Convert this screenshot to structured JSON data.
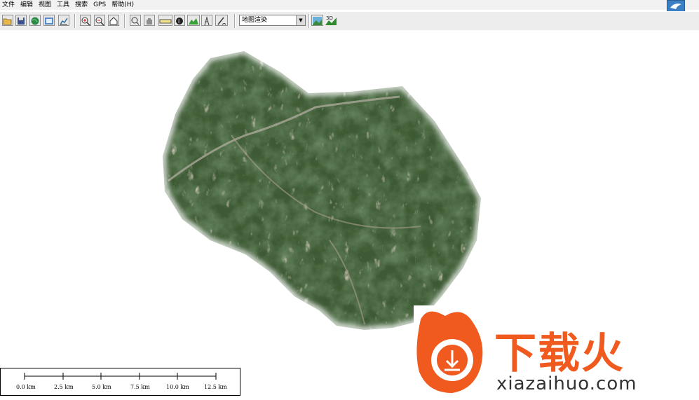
{
  "menubar": {
    "items": [
      {
        "label": "文件"
      },
      {
        "label": "编辑"
      },
      {
        "label": "视图"
      },
      {
        "label": "工具"
      },
      {
        "label": "搜索"
      },
      {
        "label": "GPS"
      },
      {
        "label": "帮助(H)"
      }
    ]
  },
  "toolbar": {
    "buttons": [
      {
        "icon": "open-folder-icon"
      },
      {
        "icon": "save-icon"
      },
      {
        "icon": "globe-icon"
      },
      {
        "icon": "export-map-icon"
      },
      {
        "icon": "chart-icon"
      },
      {
        "icon": "zoom-in-icon"
      },
      {
        "icon": "zoom-out-icon"
      },
      {
        "icon": "home-icon"
      },
      {
        "icon": "select-tool-icon"
      },
      {
        "icon": "pan-hand-icon"
      },
      {
        "icon": "measure-ruler-icon"
      },
      {
        "icon": "info-icon"
      },
      {
        "icon": "terrain-profile-icon"
      },
      {
        "icon": "gps-tower-icon"
      },
      {
        "icon": "draw-pen-icon"
      },
      {
        "icon": "map-view-icon"
      },
      {
        "icon": "3d-view-icon"
      }
    ],
    "layer_select_value": "地图渲染",
    "view_3d_label": "3D"
  },
  "scalebar": {
    "labels": [
      "0.0 km",
      "2.5 km",
      "5.0 km",
      "7.5 km",
      "10.0 km",
      "12.5 km"
    ]
  },
  "watermark": {
    "brand": "下载火",
    "url": "xiazaihuo.com"
  },
  "colors": {
    "map_dark_green": "#2f4a2a",
    "map_mid_green": "#4a6a3a",
    "map_ridge": "#9a8e78",
    "brand_orange": "#f05a1e"
  }
}
